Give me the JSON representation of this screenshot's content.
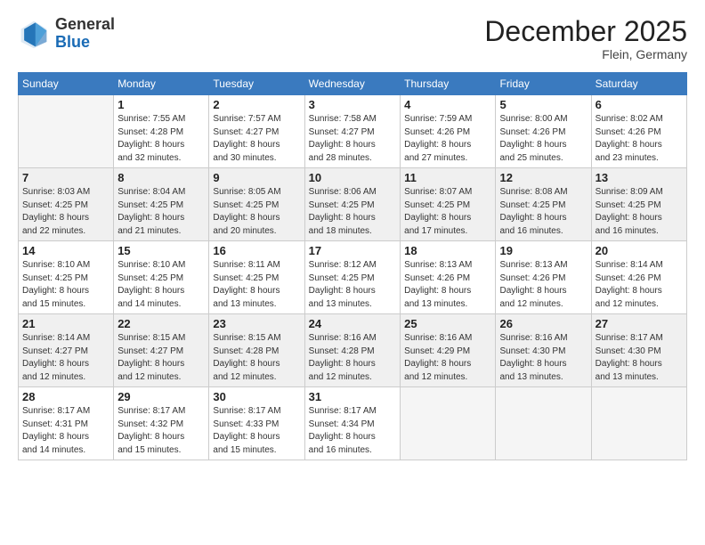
{
  "header": {
    "logo_line1": "General",
    "logo_line2": "Blue",
    "month_year": "December 2025",
    "location": "Flein, Germany"
  },
  "days_of_week": [
    "Sunday",
    "Monday",
    "Tuesday",
    "Wednesday",
    "Thursday",
    "Friday",
    "Saturday"
  ],
  "weeks": [
    [
      {
        "day": "",
        "info": ""
      },
      {
        "day": "1",
        "info": "Sunrise: 7:55 AM\nSunset: 4:28 PM\nDaylight: 8 hours\nand 32 minutes."
      },
      {
        "day": "2",
        "info": "Sunrise: 7:57 AM\nSunset: 4:27 PM\nDaylight: 8 hours\nand 30 minutes."
      },
      {
        "day": "3",
        "info": "Sunrise: 7:58 AM\nSunset: 4:27 PM\nDaylight: 8 hours\nand 28 minutes."
      },
      {
        "day": "4",
        "info": "Sunrise: 7:59 AM\nSunset: 4:26 PM\nDaylight: 8 hours\nand 27 minutes."
      },
      {
        "day": "5",
        "info": "Sunrise: 8:00 AM\nSunset: 4:26 PM\nDaylight: 8 hours\nand 25 minutes."
      },
      {
        "day": "6",
        "info": "Sunrise: 8:02 AM\nSunset: 4:26 PM\nDaylight: 8 hours\nand 23 minutes."
      }
    ],
    [
      {
        "day": "7",
        "info": "Sunrise: 8:03 AM\nSunset: 4:25 PM\nDaylight: 8 hours\nand 22 minutes."
      },
      {
        "day": "8",
        "info": "Sunrise: 8:04 AM\nSunset: 4:25 PM\nDaylight: 8 hours\nand 21 minutes."
      },
      {
        "day": "9",
        "info": "Sunrise: 8:05 AM\nSunset: 4:25 PM\nDaylight: 8 hours\nand 20 minutes."
      },
      {
        "day": "10",
        "info": "Sunrise: 8:06 AM\nSunset: 4:25 PM\nDaylight: 8 hours\nand 18 minutes."
      },
      {
        "day": "11",
        "info": "Sunrise: 8:07 AM\nSunset: 4:25 PM\nDaylight: 8 hours\nand 17 minutes."
      },
      {
        "day": "12",
        "info": "Sunrise: 8:08 AM\nSunset: 4:25 PM\nDaylight: 8 hours\nand 16 minutes."
      },
      {
        "day": "13",
        "info": "Sunrise: 8:09 AM\nSunset: 4:25 PM\nDaylight: 8 hours\nand 16 minutes."
      }
    ],
    [
      {
        "day": "14",
        "info": "Sunrise: 8:10 AM\nSunset: 4:25 PM\nDaylight: 8 hours\nand 15 minutes."
      },
      {
        "day": "15",
        "info": "Sunrise: 8:10 AM\nSunset: 4:25 PM\nDaylight: 8 hours\nand 14 minutes."
      },
      {
        "day": "16",
        "info": "Sunrise: 8:11 AM\nSunset: 4:25 PM\nDaylight: 8 hours\nand 13 minutes."
      },
      {
        "day": "17",
        "info": "Sunrise: 8:12 AM\nSunset: 4:25 PM\nDaylight: 8 hours\nand 13 minutes."
      },
      {
        "day": "18",
        "info": "Sunrise: 8:13 AM\nSunset: 4:26 PM\nDaylight: 8 hours\nand 13 minutes."
      },
      {
        "day": "19",
        "info": "Sunrise: 8:13 AM\nSunset: 4:26 PM\nDaylight: 8 hours\nand 12 minutes."
      },
      {
        "day": "20",
        "info": "Sunrise: 8:14 AM\nSunset: 4:26 PM\nDaylight: 8 hours\nand 12 minutes."
      }
    ],
    [
      {
        "day": "21",
        "info": "Sunrise: 8:14 AM\nSunset: 4:27 PM\nDaylight: 8 hours\nand 12 minutes."
      },
      {
        "day": "22",
        "info": "Sunrise: 8:15 AM\nSunset: 4:27 PM\nDaylight: 8 hours\nand 12 minutes."
      },
      {
        "day": "23",
        "info": "Sunrise: 8:15 AM\nSunset: 4:28 PM\nDaylight: 8 hours\nand 12 minutes."
      },
      {
        "day": "24",
        "info": "Sunrise: 8:16 AM\nSunset: 4:28 PM\nDaylight: 8 hours\nand 12 minutes."
      },
      {
        "day": "25",
        "info": "Sunrise: 8:16 AM\nSunset: 4:29 PM\nDaylight: 8 hours\nand 12 minutes."
      },
      {
        "day": "26",
        "info": "Sunrise: 8:16 AM\nSunset: 4:30 PM\nDaylight: 8 hours\nand 13 minutes."
      },
      {
        "day": "27",
        "info": "Sunrise: 8:17 AM\nSunset: 4:30 PM\nDaylight: 8 hours\nand 13 minutes."
      }
    ],
    [
      {
        "day": "28",
        "info": "Sunrise: 8:17 AM\nSunset: 4:31 PM\nDaylight: 8 hours\nand 14 minutes."
      },
      {
        "day": "29",
        "info": "Sunrise: 8:17 AM\nSunset: 4:32 PM\nDaylight: 8 hours\nand 15 minutes."
      },
      {
        "day": "30",
        "info": "Sunrise: 8:17 AM\nSunset: 4:33 PM\nDaylight: 8 hours\nand 15 minutes."
      },
      {
        "day": "31",
        "info": "Sunrise: 8:17 AM\nSunset: 4:34 PM\nDaylight: 8 hours\nand 16 minutes."
      },
      {
        "day": "",
        "info": ""
      },
      {
        "day": "",
        "info": ""
      },
      {
        "day": "",
        "info": ""
      }
    ]
  ]
}
